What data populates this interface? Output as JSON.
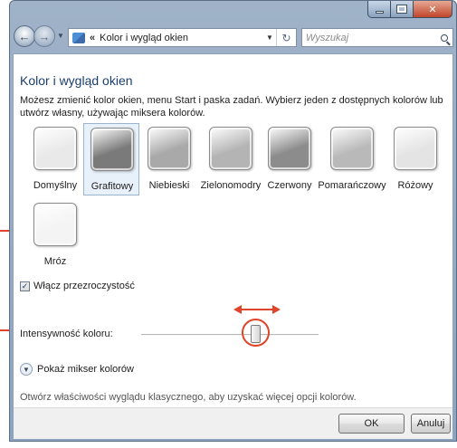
{
  "navbar": {
    "breadcrumb_sep": "«",
    "address": "Kolor i wygląd okien",
    "search_placeholder": "Wyszukaj"
  },
  "page": {
    "title": "Kolor i wygląd okien",
    "description": "Możesz zmienić kolor okien, menu Start i paska zadań. Wybierz jeden z dostępnych kolorów lub utwórz własny, używając miksera kolorów."
  },
  "swatches": [
    {
      "label": "Domyślny",
      "color": "#e9e9e9",
      "selected": false
    },
    {
      "label": "Grafitowy",
      "color": "#7a7a7a",
      "selected": true
    },
    {
      "label": "Niebieski",
      "color": "#a9a9a9",
      "selected": false
    },
    {
      "label": "Zielonomodry",
      "color": "#b4b4b4",
      "selected": false
    },
    {
      "label": "Czerwony",
      "color": "#8c8c8c",
      "selected": false
    },
    {
      "label": "Pomarańczowy",
      "color": "#b9b9b9",
      "selected": false
    },
    {
      "label": "Różowy",
      "color": "#e4e4e4",
      "selected": false
    },
    {
      "label": "Mróz",
      "color": "#f4f4f4",
      "selected": false
    }
  ],
  "transparency": {
    "label": "Włącz przezroczystość",
    "checked": true
  },
  "intensity": {
    "label": "Intensywność koloru:",
    "level": 0.65
  },
  "mixer": {
    "label": "Pokaż mikser kolorów"
  },
  "classic_link": "Otwórz właściwości wyglądu klasycznego, aby uzyskać więcej opcji kolorów.",
  "buttons": {
    "ok": "OK",
    "cancel": "Anuluj"
  },
  "colors": {
    "annotation": "#e0442a",
    "title_blue": "#1a3e6e"
  }
}
